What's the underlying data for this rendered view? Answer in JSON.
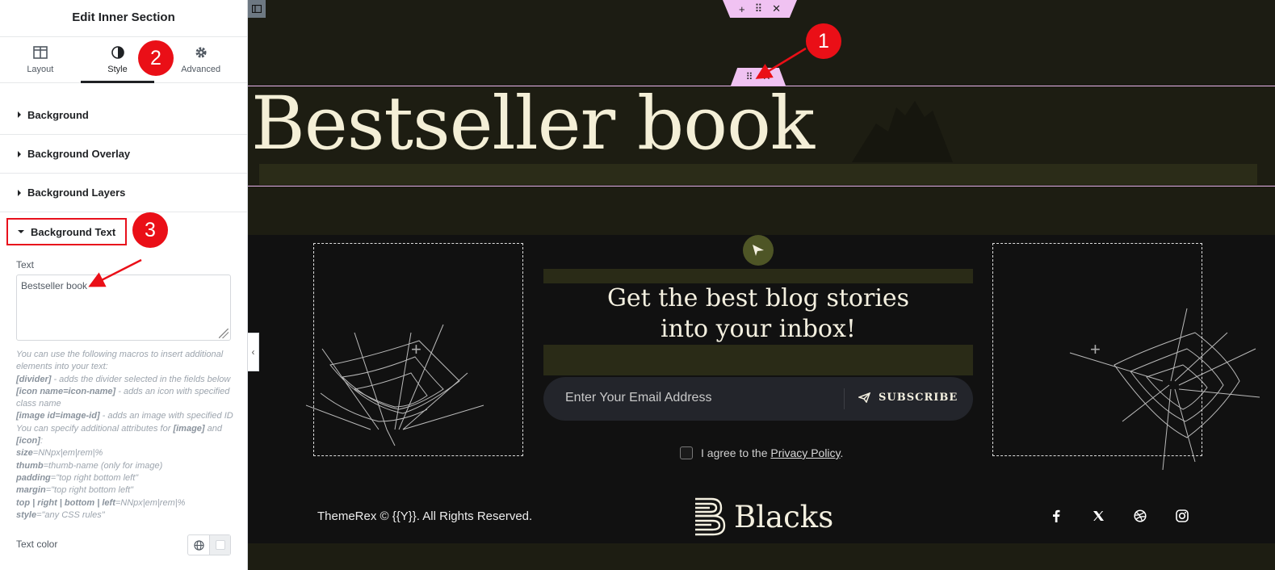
{
  "panel": {
    "title": "Edit Inner Section",
    "tabs": [
      {
        "label": "Layout",
        "icon": "columns-icon"
      },
      {
        "label": "Style",
        "icon": "half-circle-icon",
        "active": true
      },
      {
        "label": "Advanced",
        "icon": "gear-icon"
      }
    ],
    "sections": [
      {
        "label": "Background"
      },
      {
        "label": "Background Overlay"
      },
      {
        "label": "Background Layers"
      },
      {
        "label": "Background Text",
        "open": true
      }
    ],
    "text_field": {
      "label": "Text",
      "value": "Bestseller book"
    },
    "help": {
      "intro": "You can use the following macros to insert additional elements into your text:",
      "divider_tag": "[divider]",
      "divider_desc": " - adds the divider selected in the fields below",
      "icon_tag": "[icon name=icon-name]",
      "icon_desc": " - adds an icon with specified class name",
      "image_tag": "[image id=image-id]",
      "image_desc": " - adds an image with specified ID",
      "attrs_intro": "You can specify additional attributes for ",
      "attrs_image": "[image]",
      "attrs_and": " and ",
      "attrs_icon": "[icon]",
      "attrs_colon": ":",
      "size_key": "size",
      "size_val": "=NNpx|em|rem|%",
      "thumb_key": "thumb",
      "thumb_val": "=thumb-name (only for image)",
      "padding_key": "padding",
      "padding_val": "=\"top right bottom left\"",
      "margin_key": "margin",
      "margin_val": "=\"top right bottom left\"",
      "pos_key": "top | right | bottom | left",
      "pos_val": "=NNpx|em|rem|%",
      "style_key": "style",
      "style_val": "=\"any CSS rules\""
    },
    "text_color_label": "Text color"
  },
  "annotations": {
    "badge1": "1",
    "badge2": "2",
    "badge3": "3",
    "color": "#ea0f17"
  },
  "canvas": {
    "hero_text": "Bestseller book",
    "newsletter": {
      "heading_line1": "Get the best blog stories",
      "heading_line2": "into your inbox!",
      "email_placeholder": "Enter Your Email Address",
      "subscribe_label": "SUBSCRIBE",
      "agree_prefix": "I agree to the ",
      "agree_link": "Privacy Policy",
      "agree_suffix": "."
    },
    "footer": {
      "copyright": "ThemeRex © {{Y}}. All Rights Reserved.",
      "logo_text": "Blacks",
      "social": [
        "facebook-icon",
        "x-twitter-icon",
        "dribbble-icon",
        "instagram-icon"
      ]
    },
    "colors": {
      "handle": "#f0c2f2",
      "background": "#1c1d13",
      "section_dark": "#111111"
    }
  }
}
